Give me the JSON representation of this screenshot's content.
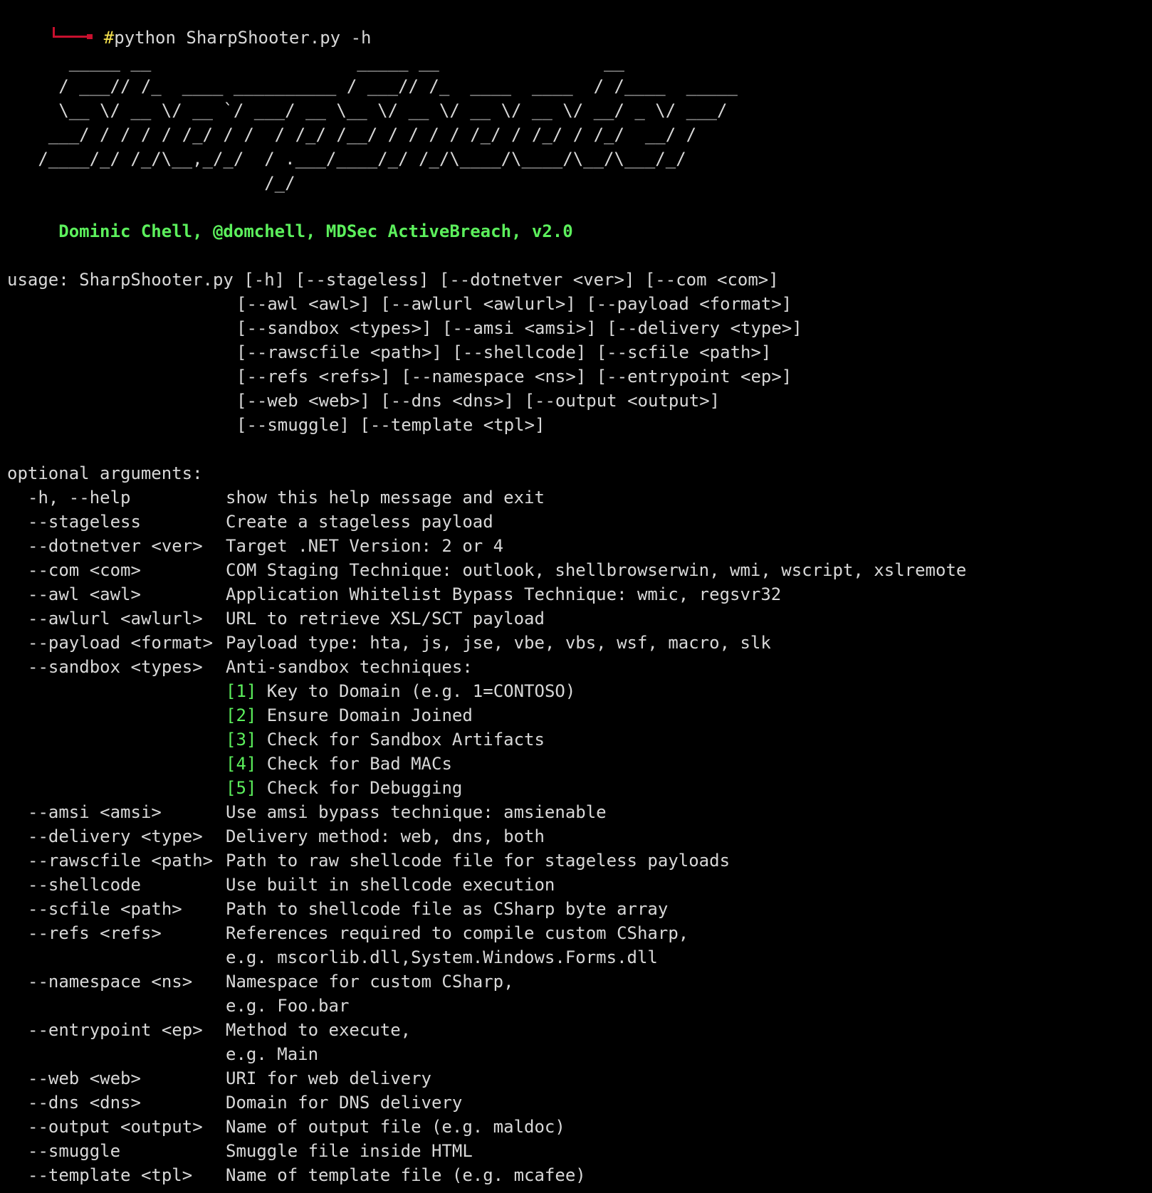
{
  "prompt": {
    "hash": "#",
    "command": "python SharpShooter.py -h"
  },
  "banner": [
    "      _____ __                    _____ __                __",
    "     / ___// /_  ____ __________ / ___// /_  ____  ____  / /____  _____",
    "     \\__ \\/ __ \\/ __ `/ ___/ __ \\__ \\/ __ \\/ __ \\/ __ \\/ __/ _ \\/ ___/",
    "    ___/ / / / / /_/ / /  / /_/ /__/ / / / / /_/ / /_/ / /_/  __/ /",
    "   /____/_/ /_/\\__,_/_/  / .___/____/_/ /_/\\____/\\____/\\__/\\___/_/",
    "                         /_/"
  ],
  "credit": "     Dominic Chell, @domchell, MDSec ActiveBreach, v2.0",
  "usage": {
    "first": "usage: SharpShooter.py [-h] [--stageless] [--dotnetver <ver>] [--com <com>]",
    "continuation": [
      "[--awl <awl>] [--awlurl <awlurl>] [--payload <format>]",
      "[--sandbox <types>] [--amsi <amsi>] [--delivery <type>]",
      "[--rawscfile <path>] [--shellcode] [--scfile <path>]",
      "[--refs <refs>] [--namespace <ns>] [--entrypoint <ep>]",
      "[--web <web>] [--dns <dns>] [--output <output>]",
      "[--smuggle] [--template <tpl>]"
    ]
  },
  "optional_heading": "optional arguments:",
  "options": {
    "help": {
      "flag": "-h, --help",
      "desc": "show this help message and exit"
    },
    "stageless": {
      "flag": "--stageless",
      "desc": "Create a stageless payload"
    },
    "dotnetver": {
      "flag": "--dotnetver <ver>",
      "desc": "Target .NET Version: 2 or 4"
    },
    "com": {
      "flag": "--com <com>",
      "desc": "COM Staging Technique: outlook, shellbrowserwin, wmi, wscript, xslremote"
    },
    "awl": {
      "flag": "--awl <awl>",
      "desc": "Application Whitelist Bypass Technique: wmic, regsvr32"
    },
    "awlurl": {
      "flag": "--awlurl <awlurl>",
      "desc": "URL to retrieve XSL/SCT payload"
    },
    "payload": {
      "flag": "--payload <format>",
      "desc": "Payload type: hta, js, jse, vbe, vbs, wsf, macro, slk"
    },
    "sandbox": {
      "flag": "--sandbox <types>",
      "desc": "Anti-sandbox techniques:"
    },
    "sandbox_items": [
      {
        "num": "[1]",
        "text": " Key to Domain (e.g. 1=CONTOSO)"
      },
      {
        "num": "[2]",
        "text": " Ensure Domain Joined"
      },
      {
        "num": "[3]",
        "text": " Check for Sandbox Artifacts"
      },
      {
        "num": "[4]",
        "text": " Check for Bad MACs"
      },
      {
        "num": "[5]",
        "text": " Check for Debugging"
      }
    ],
    "amsi": {
      "flag": "--amsi <amsi>",
      "desc": "Use amsi bypass technique: amsienable"
    },
    "delivery": {
      "flag": "--delivery <type>",
      "desc": "Delivery method: web, dns, both"
    },
    "rawscfile": {
      "flag": "--rawscfile <path>",
      "desc": "Path to raw shellcode file for stageless payloads"
    },
    "shellcode": {
      "flag": "--shellcode",
      "desc": "Use built in shellcode execution"
    },
    "scfile": {
      "flag": "--scfile <path>",
      "desc": "Path to shellcode file as CSharp byte array"
    },
    "refs": {
      "flag": "--refs <refs>",
      "desc": "References required to compile custom CSharp,",
      "cont": "e.g. mscorlib.dll,System.Windows.Forms.dll"
    },
    "namespace": {
      "flag": "--namespace <ns>",
      "desc": "Namespace for custom CSharp,",
      "cont": "e.g. Foo.bar"
    },
    "entrypoint": {
      "flag": "--entrypoint <ep>",
      "desc": "Method to execute,",
      "cont": "e.g. Main"
    },
    "web": {
      "flag": "--web <web>",
      "desc": "URI for web delivery"
    },
    "dns": {
      "flag": "--dns <dns>",
      "desc": "Domain for DNS delivery"
    },
    "output": {
      "flag": "--output <output>",
      "desc": "Name of output file (e.g. maldoc)"
    },
    "smuggle": {
      "flag": "--smuggle",
      "desc": "Smuggle file inside HTML"
    },
    "template": {
      "flag": "--template <tpl>",
      "desc": "Name of template file (e.g. mcafee)"
    }
  },
  "colors": {
    "background": "#000000",
    "text": "#d8d8d8",
    "prompt_arrow": "#c8102e",
    "hash": "#f4e04d",
    "credit": "#5cf05c",
    "sandbox_number": "#5cf05c"
  },
  "icons": {
    "prompt": "prompt-arrow-icon"
  }
}
